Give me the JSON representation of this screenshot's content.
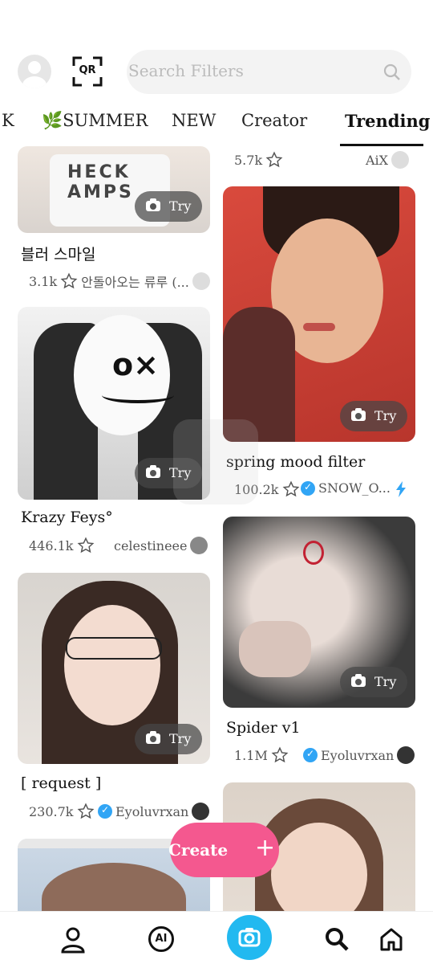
{
  "header": {
    "qr_label": "QR",
    "search_placeholder": "Search Filters"
  },
  "tabs": [
    {
      "label": "K"
    },
    {
      "label": "🌿SUMMER"
    },
    {
      "label": "NEW"
    },
    {
      "label": "Creator"
    },
    {
      "label": "Trending",
      "active": true
    }
  ],
  "left_column": [
    {
      "title": "블러 스마일",
      "count": "3.1k",
      "creator": "안돌아오는 류루 (...",
      "try": "Try"
    },
    {
      "title": "Krazy Feys°",
      "count": "446.1k",
      "creator": "celestineee",
      "try": "Try"
    },
    {
      "title": "[ request ]",
      "count": "230.7k",
      "creator": "Eyoluvrxan",
      "verified": true,
      "try": "Try"
    }
  ],
  "right_column": [
    {
      "count": "5.7k",
      "creator": "AiX"
    },
    {
      "title": "spring mood filter",
      "count": "100.2k",
      "creator": "SNOW_O...",
      "verified": true,
      "try": "Try"
    },
    {
      "title": "Spider v1",
      "count": "1.1M",
      "creator": "Eyoluvrxan",
      "verified": true,
      "try": "Try"
    }
  ],
  "create_button": {
    "label": "Create",
    "plus": "+"
  },
  "bottom_nav": {
    "ai_label": "AI"
  },
  "colors": {
    "accent": "#22b9f0",
    "create": "#f4588f",
    "verified": "#31a5f5"
  }
}
